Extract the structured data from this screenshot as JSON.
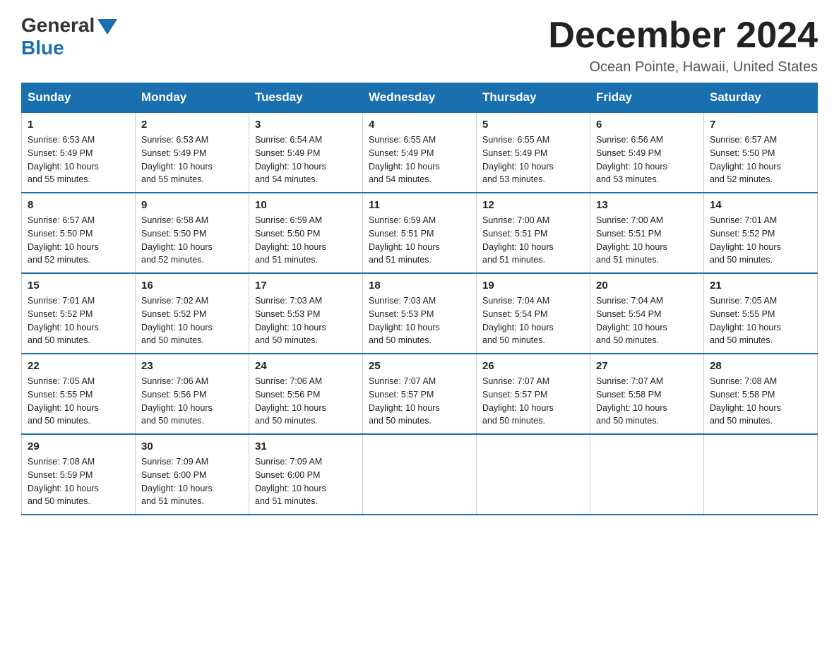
{
  "header": {
    "logo_general": "General",
    "logo_blue": "Blue",
    "month_title": "December 2024",
    "location": "Ocean Pointe, Hawaii, United States"
  },
  "weekdays": [
    "Sunday",
    "Monday",
    "Tuesday",
    "Wednesday",
    "Thursday",
    "Friday",
    "Saturday"
  ],
  "weeks": [
    [
      {
        "day": "1",
        "sunrise": "6:53 AM",
        "sunset": "5:49 PM",
        "daylight": "10 hours and 55 minutes."
      },
      {
        "day": "2",
        "sunrise": "6:53 AM",
        "sunset": "5:49 PM",
        "daylight": "10 hours and 55 minutes."
      },
      {
        "day": "3",
        "sunrise": "6:54 AM",
        "sunset": "5:49 PM",
        "daylight": "10 hours and 54 minutes."
      },
      {
        "day": "4",
        "sunrise": "6:55 AM",
        "sunset": "5:49 PM",
        "daylight": "10 hours and 54 minutes."
      },
      {
        "day": "5",
        "sunrise": "6:55 AM",
        "sunset": "5:49 PM",
        "daylight": "10 hours and 53 minutes."
      },
      {
        "day": "6",
        "sunrise": "6:56 AM",
        "sunset": "5:49 PM",
        "daylight": "10 hours and 53 minutes."
      },
      {
        "day": "7",
        "sunrise": "6:57 AM",
        "sunset": "5:50 PM",
        "daylight": "10 hours and 52 minutes."
      }
    ],
    [
      {
        "day": "8",
        "sunrise": "6:57 AM",
        "sunset": "5:50 PM",
        "daylight": "10 hours and 52 minutes."
      },
      {
        "day": "9",
        "sunrise": "6:58 AM",
        "sunset": "5:50 PM",
        "daylight": "10 hours and 52 minutes."
      },
      {
        "day": "10",
        "sunrise": "6:59 AM",
        "sunset": "5:50 PM",
        "daylight": "10 hours and 51 minutes."
      },
      {
        "day": "11",
        "sunrise": "6:59 AM",
        "sunset": "5:51 PM",
        "daylight": "10 hours and 51 minutes."
      },
      {
        "day": "12",
        "sunrise": "7:00 AM",
        "sunset": "5:51 PM",
        "daylight": "10 hours and 51 minutes."
      },
      {
        "day": "13",
        "sunrise": "7:00 AM",
        "sunset": "5:51 PM",
        "daylight": "10 hours and 51 minutes."
      },
      {
        "day": "14",
        "sunrise": "7:01 AM",
        "sunset": "5:52 PM",
        "daylight": "10 hours and 50 minutes."
      }
    ],
    [
      {
        "day": "15",
        "sunrise": "7:01 AM",
        "sunset": "5:52 PM",
        "daylight": "10 hours and 50 minutes."
      },
      {
        "day": "16",
        "sunrise": "7:02 AM",
        "sunset": "5:52 PM",
        "daylight": "10 hours and 50 minutes."
      },
      {
        "day": "17",
        "sunrise": "7:03 AM",
        "sunset": "5:53 PM",
        "daylight": "10 hours and 50 minutes."
      },
      {
        "day": "18",
        "sunrise": "7:03 AM",
        "sunset": "5:53 PM",
        "daylight": "10 hours and 50 minutes."
      },
      {
        "day": "19",
        "sunrise": "7:04 AM",
        "sunset": "5:54 PM",
        "daylight": "10 hours and 50 minutes."
      },
      {
        "day": "20",
        "sunrise": "7:04 AM",
        "sunset": "5:54 PM",
        "daylight": "10 hours and 50 minutes."
      },
      {
        "day": "21",
        "sunrise": "7:05 AM",
        "sunset": "5:55 PM",
        "daylight": "10 hours and 50 minutes."
      }
    ],
    [
      {
        "day": "22",
        "sunrise": "7:05 AM",
        "sunset": "5:55 PM",
        "daylight": "10 hours and 50 minutes."
      },
      {
        "day": "23",
        "sunrise": "7:06 AM",
        "sunset": "5:56 PM",
        "daylight": "10 hours and 50 minutes."
      },
      {
        "day": "24",
        "sunrise": "7:06 AM",
        "sunset": "5:56 PM",
        "daylight": "10 hours and 50 minutes."
      },
      {
        "day": "25",
        "sunrise": "7:07 AM",
        "sunset": "5:57 PM",
        "daylight": "10 hours and 50 minutes."
      },
      {
        "day": "26",
        "sunrise": "7:07 AM",
        "sunset": "5:57 PM",
        "daylight": "10 hours and 50 minutes."
      },
      {
        "day": "27",
        "sunrise": "7:07 AM",
        "sunset": "5:58 PM",
        "daylight": "10 hours and 50 minutes."
      },
      {
        "day": "28",
        "sunrise": "7:08 AM",
        "sunset": "5:58 PM",
        "daylight": "10 hours and 50 minutes."
      }
    ],
    [
      {
        "day": "29",
        "sunrise": "7:08 AM",
        "sunset": "5:59 PM",
        "daylight": "10 hours and 50 minutes."
      },
      {
        "day": "30",
        "sunrise": "7:09 AM",
        "sunset": "6:00 PM",
        "daylight": "10 hours and 51 minutes."
      },
      {
        "day": "31",
        "sunrise": "7:09 AM",
        "sunset": "6:00 PM",
        "daylight": "10 hours and 51 minutes."
      },
      null,
      null,
      null,
      null
    ]
  ],
  "labels": {
    "sunrise": "Sunrise:",
    "sunset": "Sunset:",
    "daylight": "Daylight:"
  }
}
